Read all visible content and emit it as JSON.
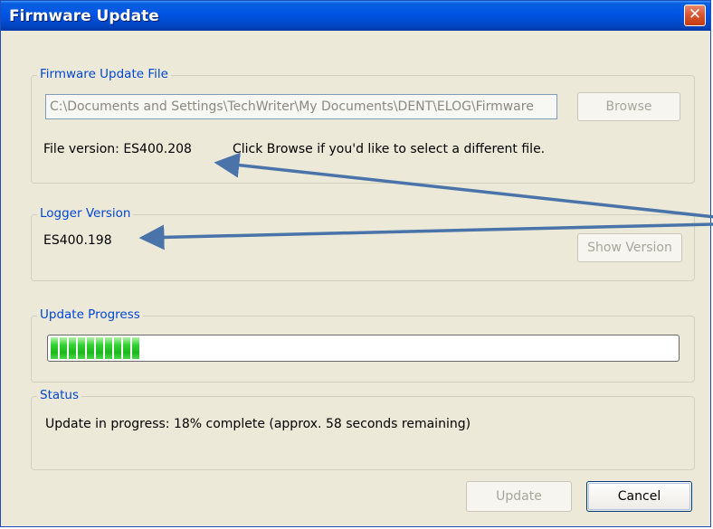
{
  "window": {
    "title": "Firmware Update",
    "close_symbol": "✕"
  },
  "firmware_file": {
    "legend": "Firmware Update File",
    "path": "C:\\Documents and Settings\\TechWriter\\My Documents\\DENT\\ELOG\\Firmware",
    "browse_label": "Browse",
    "version_text": "File version: ES400.208",
    "hint_text": "Click Browse if you'd like to select a different file."
  },
  "logger_version": {
    "legend": "Logger Version",
    "value": "ES400.198",
    "show_version_label": "Show Version"
  },
  "update_progress": {
    "legend": "Update Progress",
    "progress_percent": 18,
    "segments": 10
  },
  "status": {
    "legend": "Status",
    "text": "Update in progress: 18% complete  (approx. 58 seconds remaining)"
  },
  "buttons": {
    "update_label": "Update",
    "cancel_label": "Cancel"
  },
  "colors": {
    "annotation_arrow": "#4a73aa",
    "progress_green": "#1cb61c"
  }
}
